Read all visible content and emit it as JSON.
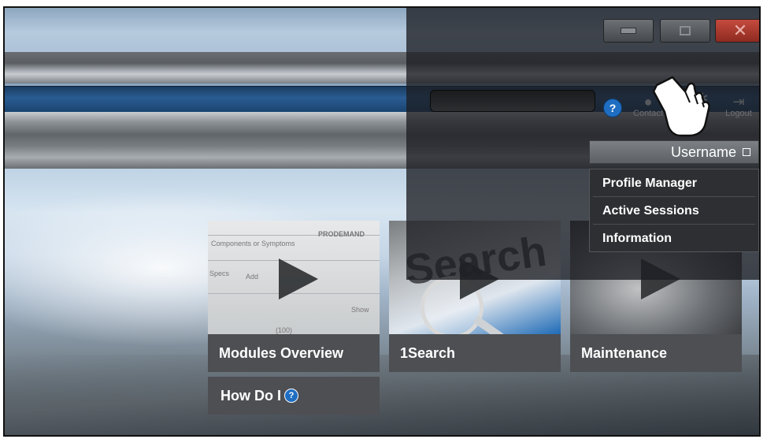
{
  "window_controls": {
    "minimize_icon": "minimize-icon",
    "maximize_icon": "maximize-icon",
    "close_icon": "close-icon",
    "close_glyph": "✕"
  },
  "toolbar": {
    "help_glyph": "?",
    "contact_label": "Contact",
    "settings_label": "gs",
    "logout_label": "Logout"
  },
  "user_menu": {
    "username": "Username",
    "items": [
      {
        "label": "Profile Manager"
      },
      {
        "label": "Active Sessions"
      },
      {
        "label": "Information"
      }
    ]
  },
  "tiles": [
    {
      "label": "Modules Overview",
      "thumb_text": [
        "Components or Symptoms",
        "PRODEMAND",
        "Specs",
        "Add",
        "Show",
        "(100)"
      ]
    },
    {
      "label": "1Search",
      "thumb_text": [
        "Search"
      ]
    },
    {
      "label": "Maintenance"
    }
  ],
  "how_do_i": {
    "label": "How Do I",
    "help_glyph": "?"
  },
  "colors": {
    "accent_blue": "#1f6ec2",
    "caption_bg": "#4d4f53",
    "close_red": "#c54a3e"
  }
}
